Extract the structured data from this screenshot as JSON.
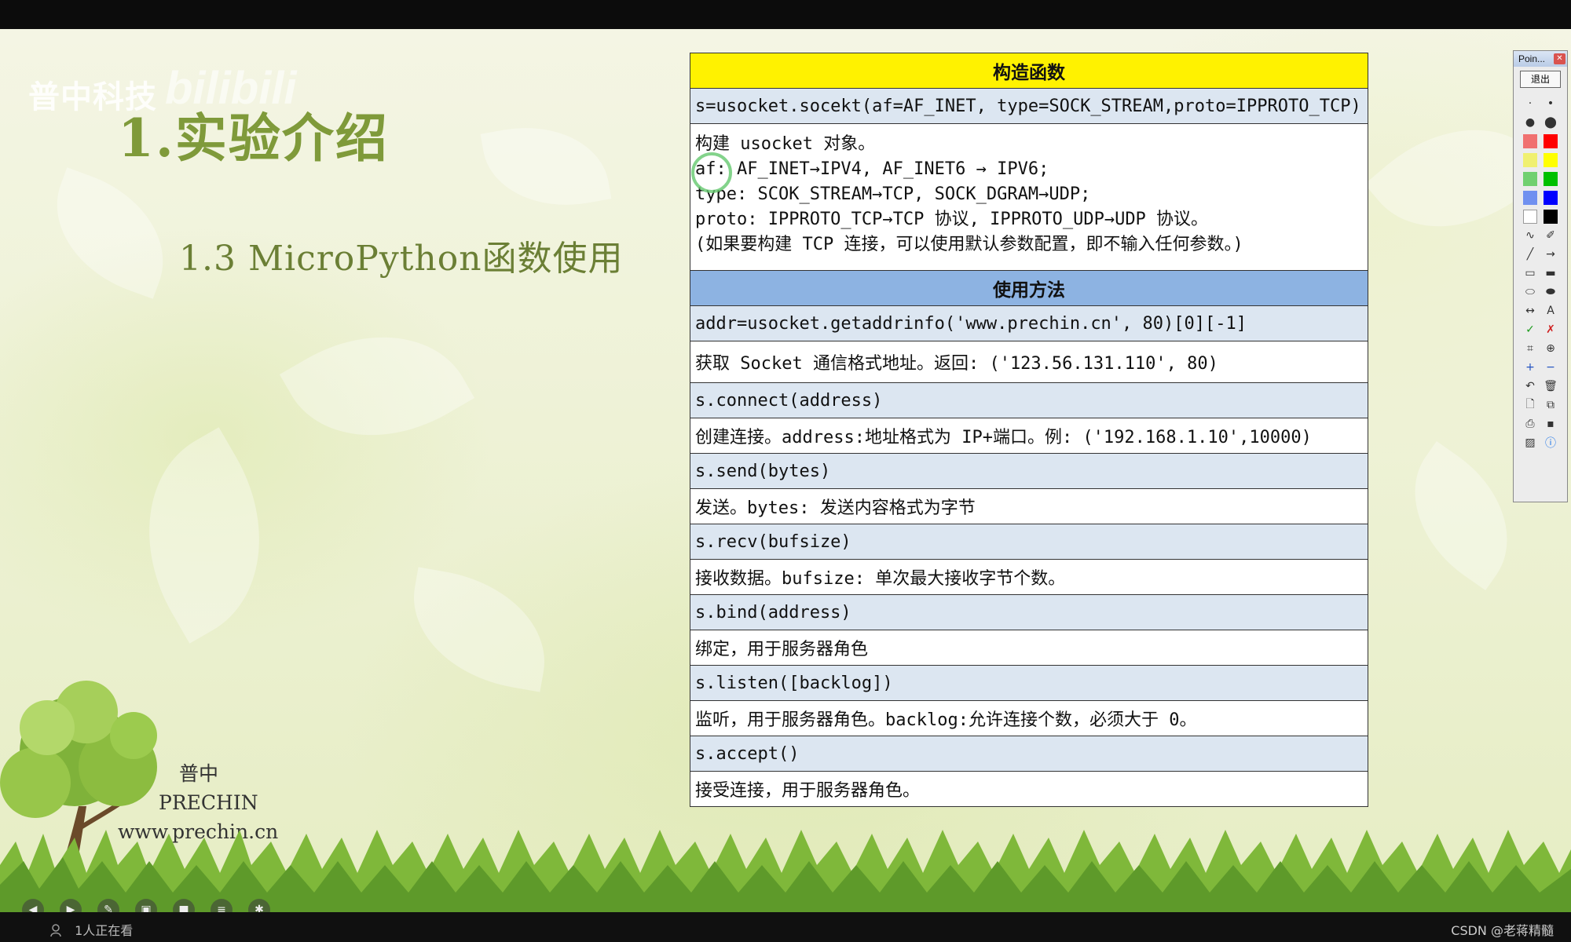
{
  "watermark": {
    "text": "普中科技",
    "logo": "bilibili"
  },
  "slide": {
    "title": "1.实验介绍",
    "subtitle": "1.3 MicroPython函数使用"
  },
  "brand": {
    "line1": "普中",
    "line2": "PRECHIN",
    "line3": "www.prechin.cn"
  },
  "table": {
    "header_constructor": "构造函数",
    "constructor_code": "s=usocket.socekt(af=AF_INET, type=SOCK_STREAM,proto=IPPROTO_TCP)",
    "constructor_desc": [
      "构建 usocket 对象。",
      "af: AF_INET→IPV4, AF_INET6 → IPV6;",
      "type: SCOK_STREAM→TCP, SOCK_DGRAM→UDP;",
      "proto: IPPROTO_TCP→TCP 协议, IPPROTO_UDP→UDP 协议。",
      "(如果要构建 TCP 连接，可以使用默认参数配置，即不输入任何参数。)"
    ],
    "header_usage": "使用方法",
    "methods": [
      {
        "code": "addr=usocket.getaddrinfo('www.prechin.cn', 80)[0][-1]",
        "desc": "获取 Socket 通信格式地址。返回: ('123.56.131.110', 80)"
      },
      {
        "code": "s.connect(address)",
        "desc": "创建连接。address:地址格式为 IP+端口。例: ('192.168.1.10',10000)"
      },
      {
        "code": "s.send(bytes)",
        "desc": "发送。bytes: 发送内容格式为字节"
      },
      {
        "code": "s.recv(bufsize)",
        "desc": "接收数据。bufsize: 单次最大接收字节个数。"
      },
      {
        "code": "s.bind(address)",
        "desc": "绑定，用于服务器角色"
      },
      {
        "code": "s.listen([backlog])",
        "desc": "监听，用于服务器角色。backlog:允许连接个数，必须大于 0。"
      },
      {
        "code": "s.accept()",
        "desc": "接受连接，用于服务器角色。"
      }
    ]
  },
  "palette": {
    "title": "Poin...",
    "exit_label": "退出",
    "colors": [
      "#f07070",
      "#ff0000",
      "#f0f070",
      "#ffff00",
      "#70d070",
      "#00c000",
      "#7090f0",
      "#0000ff",
      "#ffffff",
      "#000000"
    ]
  },
  "statusbar": {
    "viewers": "1人正在看",
    "credit": "CSDN @老蒋精髓"
  }
}
